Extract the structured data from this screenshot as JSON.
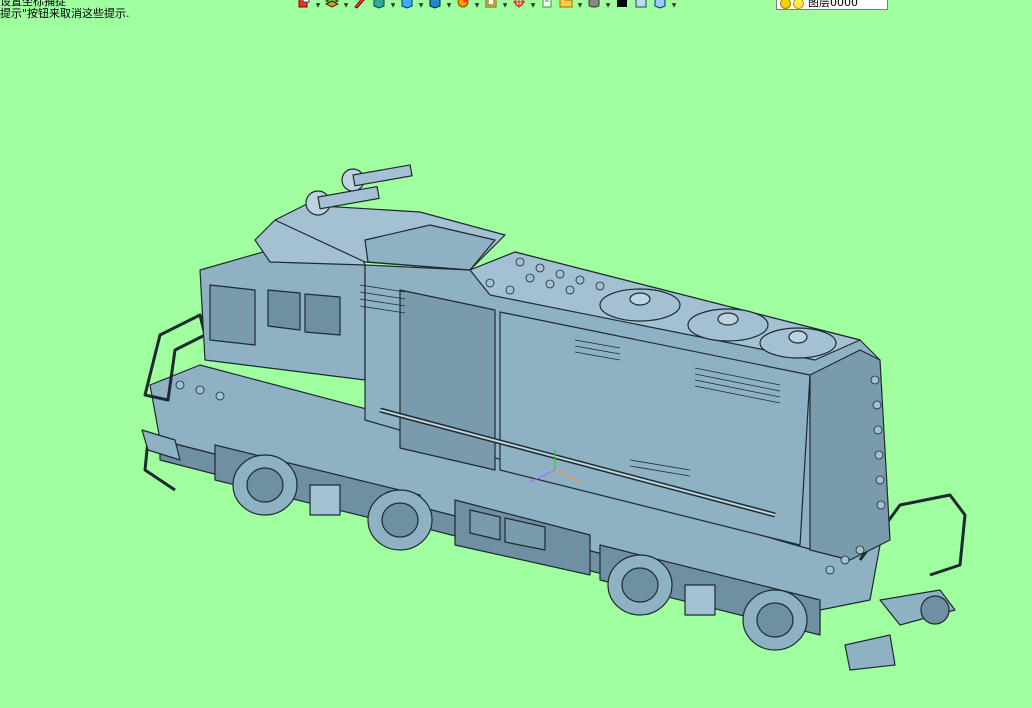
{
  "status_hint": {
    "line1": "设置坐标捕捉",
    "line2": "提示\"按钮来取消这些提示."
  },
  "toolbar": {
    "icons": [
      "new-part-icon",
      "layers-icon",
      "sketch-icon",
      "box-icon",
      "extrude-icon",
      "solid-icon",
      "color-wheel-icon",
      "measure-icon",
      "axis-icon",
      "copy-icon",
      "folder-icon",
      "database-icon",
      "color-swatch-icon",
      "frame-icon",
      "render-icon"
    ],
    "swatch_color": "#000000"
  },
  "layer_selector": {
    "current": "图层0000"
  },
  "colors": {
    "background": "#a0ff9e",
    "model": "#8fb1c4",
    "model_dark": "#6f8fa2",
    "outline": "#1e2a30"
  },
  "viewport": {
    "model_description": "locomotive-3d-model"
  }
}
